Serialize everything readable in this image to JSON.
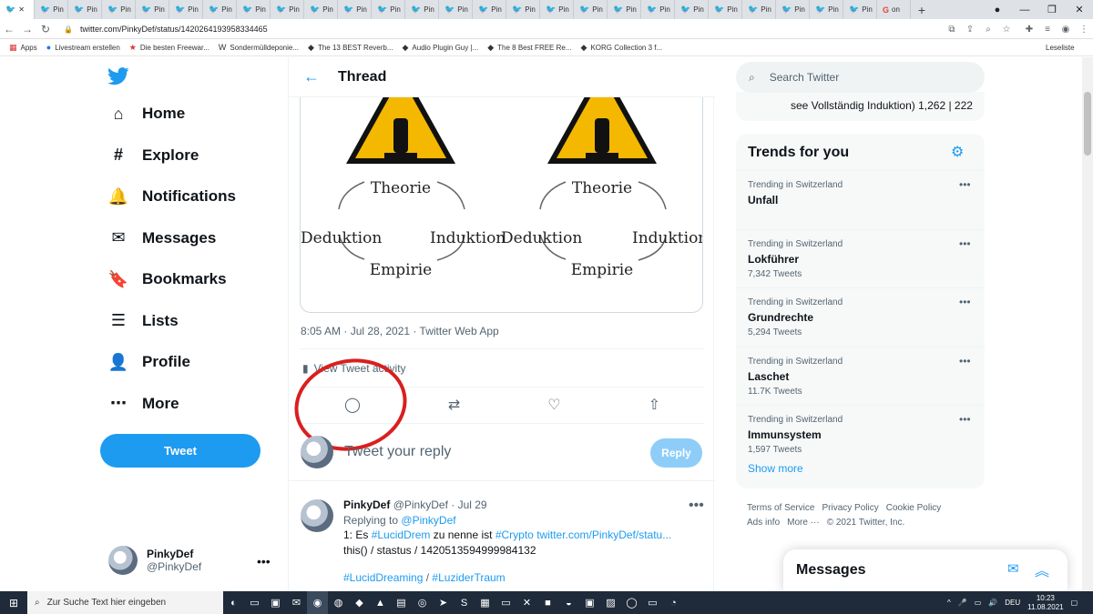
{
  "browser": {
    "tab_label": "Pin",
    "last_tab_label": "on",
    "url": "twitter.com/PinkyDef/status/1420264193958334465",
    "bookmarks": [
      {
        "label": "Apps",
        "icon": "apps-grid-icon"
      },
      {
        "label": "Livestream erstellen",
        "icon": "facebook-icon"
      },
      {
        "label": "Die besten Freewar...",
        "icon": "star-icon"
      },
      {
        "label": "Sondermülldeponie...",
        "icon": "w-icon"
      },
      {
        "label": "The 13 BEST Reverb...",
        "icon": "bookmark-icon"
      },
      {
        "label": "Audio Plugin Guy |...",
        "icon": "bookmark-icon"
      },
      {
        "label": "The 8 Best FREE Re...",
        "icon": "bookmark-icon"
      },
      {
        "label": "KORG Collection 3 f...",
        "icon": "bookmark-icon"
      }
    ],
    "reading_list": "Leseliste"
  },
  "nav": {
    "items": [
      {
        "label": "Home",
        "icon": "home-icon"
      },
      {
        "label": "Explore",
        "icon": "hashtag-icon"
      },
      {
        "label": "Notifications",
        "icon": "bell-icon"
      },
      {
        "label": "Messages",
        "icon": "mail-icon"
      },
      {
        "label": "Bookmarks",
        "icon": "bookmark-icon"
      },
      {
        "label": "Lists",
        "icon": "list-icon"
      },
      {
        "label": "Profile",
        "icon": "person-icon"
      },
      {
        "label": "More",
        "icon": "more-circle-icon"
      }
    ],
    "tweet_button": "Tweet",
    "user": {
      "name": "PinkyDef",
      "handle": "@PinkyDef"
    }
  },
  "thread": {
    "title": "Thread",
    "image": {
      "left": {
        "top": "Theorie",
        "left": "Deduktion",
        "right": "Induktion",
        "bottom": "Empirie"
      },
      "right": {
        "top": "Theorie",
        "left": "Deduktion",
        "right": "Induktion",
        "bottom": "Empirie"
      }
    },
    "meta": "8:05 AM · Jul 28, 2021 · Twitter Web App",
    "activity": "View Tweet activity",
    "reply_placeholder": "Tweet your reply",
    "reply_button": "Reply",
    "post": {
      "name": "PinkyDef",
      "handle_time": "@PinkyDef · Jul 29",
      "replying_prefix": "Replying to",
      "replying_to": "@PinkyDef",
      "line1_a": "1: Es",
      "line1_tag": "#LucidDrem",
      "line1_b": "zu nenne ist",
      "line1_tag2": "#Crypto",
      "line1_link": "twitter.com/PinkyDef/statu...",
      "line2": "this() / stastus / 1420513594999984132",
      "tags3": "#LucidDreaming",
      "sep3": "/",
      "tags3b": "#LuziderTraum"
    }
  },
  "right": {
    "search_placeholder": "Search Twitter",
    "prev_card_text": "see Vollständig Induktion) 1,262 | 222",
    "trends_title": "Trends for you",
    "trends": [
      {
        "category": "Trending in Switzerland",
        "name": "Unfall",
        "count": ""
      },
      {
        "category": "Trending in Switzerland",
        "name": "Lokführer",
        "count": "7,342 Tweets"
      },
      {
        "category": "Trending in Switzerland",
        "name": "Grundrechte",
        "count": "5,294 Tweets"
      },
      {
        "category": "Trending in Switzerland",
        "name": "Laschet",
        "count": "11.7K Tweets"
      },
      {
        "category": "Trending in Switzerland",
        "name": "Immunsystem",
        "count": "1,597 Tweets"
      }
    ],
    "show_more": "Show more",
    "footer": [
      "Terms of Service",
      "Privacy Policy",
      "Cookie Policy",
      "Ads info",
      "More ···",
      "© 2021 Twitter, Inc."
    ],
    "messages_dock": "Messages"
  },
  "taskbar": {
    "search_placeholder": "Zur Suche Text hier eingeben",
    "lang": "DEU",
    "time": "10:23",
    "date": "11.08.2021"
  },
  "colors": {
    "accent": "#1d9bf0",
    "annotation": "#d91f1f"
  }
}
